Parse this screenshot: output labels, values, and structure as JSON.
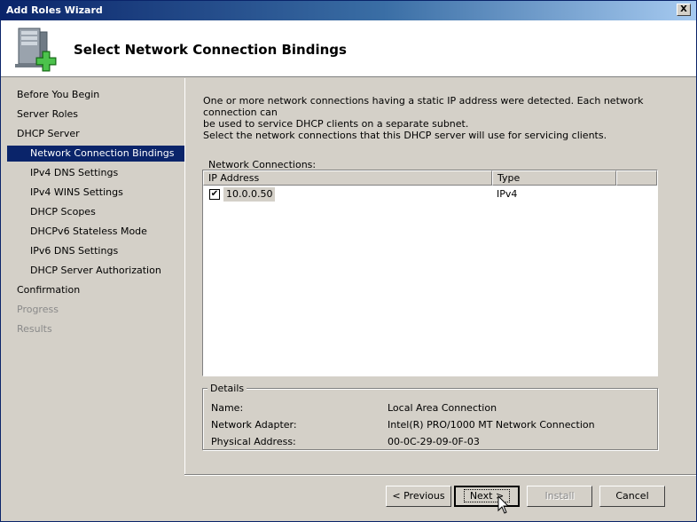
{
  "window": {
    "title": "Add Roles Wizard",
    "close_glyph": "X"
  },
  "header": {
    "title": "Select Network Connection Bindings",
    "icon": "server-add-icon"
  },
  "nav": {
    "items": [
      {
        "label": "Before You Begin",
        "level": 1,
        "state": "normal"
      },
      {
        "label": "Server Roles",
        "level": 1,
        "state": "normal"
      },
      {
        "label": "DHCP Server",
        "level": 1,
        "state": "normal"
      },
      {
        "label": "Network Connection Bindings",
        "level": 2,
        "state": "selected"
      },
      {
        "label": "IPv4 DNS Settings",
        "level": 2,
        "state": "normal"
      },
      {
        "label": "IPv4 WINS Settings",
        "level": 2,
        "state": "normal"
      },
      {
        "label": "DHCP Scopes",
        "level": 2,
        "state": "normal"
      },
      {
        "label": "DHCPv6 Stateless Mode",
        "level": 2,
        "state": "normal"
      },
      {
        "label": "IPv6 DNS Settings",
        "level": 2,
        "state": "normal"
      },
      {
        "label": "DHCP Server Authorization",
        "level": 2,
        "state": "normal"
      },
      {
        "label": "Confirmation",
        "level": 1,
        "state": "normal"
      },
      {
        "label": "Progress",
        "level": 1,
        "state": "disabled"
      },
      {
        "label": "Results",
        "level": 1,
        "state": "disabled"
      }
    ]
  },
  "content": {
    "description_line1": "One or more network connections having a static IP address were detected. Each network connection can",
    "description_line2": "be used to service DHCP clients on a separate subnet.",
    "instruction": "Select the network connections that this DHCP server will use for servicing clients.",
    "connections_label": "Network Connections:",
    "columns": [
      "IP Address",
      "Type"
    ],
    "rows": [
      {
        "checked": true,
        "check_glyph": "✔",
        "ip": "10.0.0.50",
        "type": "IPv4"
      }
    ]
  },
  "details": {
    "legend": "Details",
    "name_label": "Name:",
    "name_value": "Local Area Connection",
    "adapter_label": "Network Adapter:",
    "adapter_value": "Intel(R) PRO/1000 MT Network Connection",
    "address_label": "Physical Address:",
    "address_value": "00-0C-29-09-0F-03"
  },
  "buttons": {
    "previous": "< Previous",
    "next": "Next >",
    "install": "Install",
    "cancel": "Cancel"
  },
  "colors": {
    "selection": "#0a246a",
    "face": "#d4d0c8",
    "disabled_text": "#8a8a8a"
  }
}
